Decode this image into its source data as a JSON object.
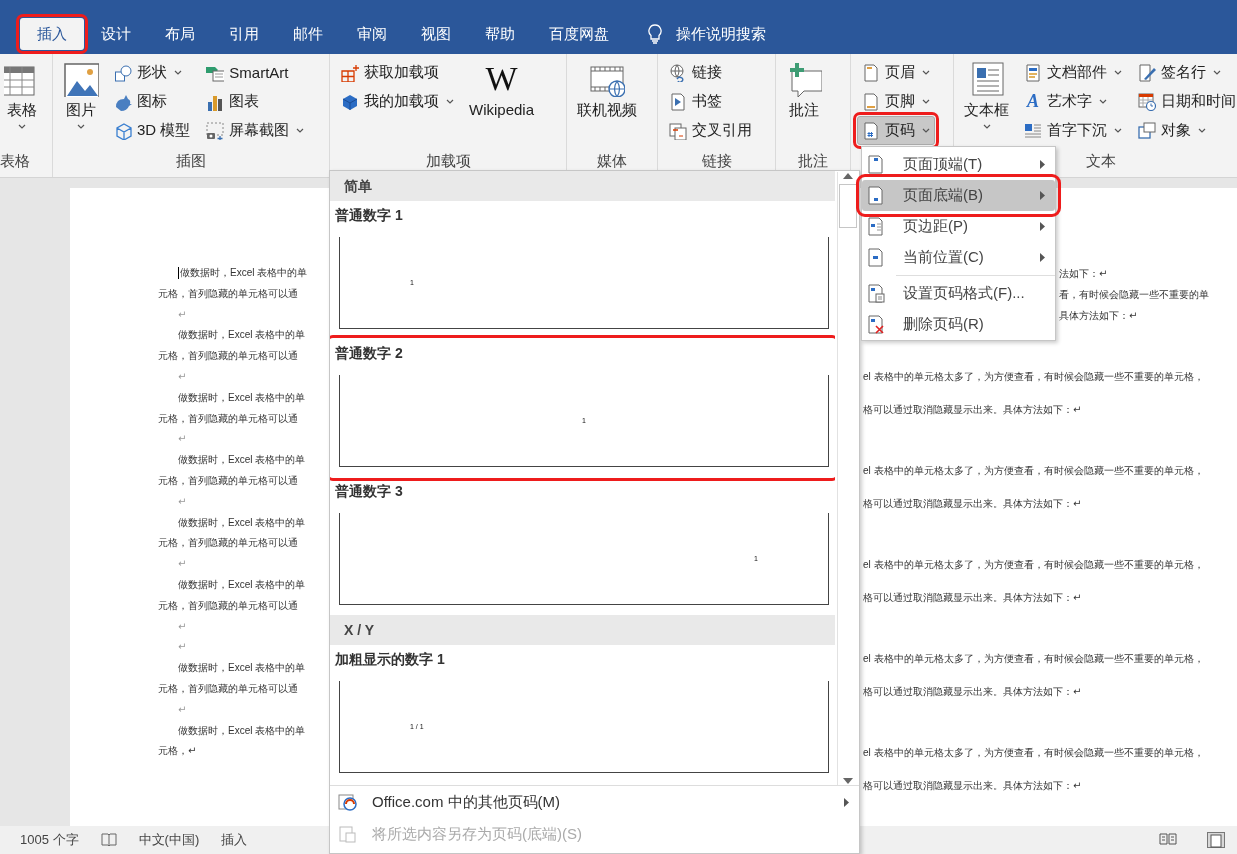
{
  "tabs": [
    {
      "label": "插入",
      "selected": true,
      "highlighted": true
    },
    {
      "label": "设计",
      "selected": false,
      "highlighted": false
    },
    {
      "label": "布局",
      "selected": false,
      "highlighted": false
    },
    {
      "label": "引用",
      "selected": false,
      "highlighted": false
    },
    {
      "label": "邮件",
      "selected": false,
      "highlighted": false
    },
    {
      "label": "审阅",
      "selected": false,
      "highlighted": false
    },
    {
      "label": "视图",
      "selected": false,
      "highlighted": false
    },
    {
      "label": "帮助",
      "selected": false,
      "highlighted": false
    },
    {
      "label": "百度网盘",
      "selected": false,
      "highlighted": false
    }
  ],
  "tell_me": {
    "label": "操作说明搜索"
  },
  "ribbon": {
    "groups": [
      {
        "label": "表格",
        "items": [
          {
            "kind": "large",
            "label": "表格",
            "dropdown": true
          }
        ]
      },
      {
        "label": "插图",
        "items": [
          {
            "kind": "large",
            "label": "图片",
            "dropdown": true
          },
          {
            "kind": "column",
            "buttons": [
              {
                "label": "形状",
                "dropdown": true
              },
              {
                "label": "图标",
                "dropdown": false
              },
              {
                "label": "3D 模型",
                "dropdown": false
              }
            ]
          },
          {
            "kind": "column",
            "buttons": [
              {
                "label": "SmartArt",
                "dropdown": false
              },
              {
                "label": "图表",
                "dropdown": false
              },
              {
                "label": "屏幕截图",
                "dropdown": true
              }
            ]
          }
        ]
      },
      {
        "label": "加载项",
        "items": [
          {
            "kind": "column",
            "buttons": [
              {
                "label": "获取加载项",
                "dropdown": false
              },
              {
                "label": "我的加载项",
                "dropdown": true
              }
            ]
          },
          {
            "kind": "large",
            "label": "Wikipedia",
            "glyph": "W",
            "dropdown": false
          }
        ]
      },
      {
        "label": "媒体",
        "items": [
          {
            "kind": "large",
            "label": "联机视频",
            "dropdown": false
          }
        ]
      },
      {
        "label": "链接",
        "items": [
          {
            "kind": "column",
            "buttons": [
              {
                "label": "链接",
                "dropdown": false
              },
              {
                "label": "书签",
                "dropdown": false
              },
              {
                "label": "交叉引用",
                "dropdown": false
              }
            ]
          }
        ]
      },
      {
        "label": "批注",
        "items": [
          {
            "kind": "large",
            "label": "批注",
            "dropdown": false
          }
        ]
      },
      {
        "items": [
          {
            "kind": "column",
            "buttons": [
              {
                "label": "页眉",
                "dropdown": true,
                "pressed": false,
                "highlighted": false
              },
              {
                "label": "页脚",
                "dropdown": true,
                "pressed": false,
                "highlighted": false
              },
              {
                "label": "页码",
                "dropdown": true,
                "pressed": true,
                "highlighted": true
              }
            ]
          }
        ]
      },
      {
        "label": "文本",
        "items": [
          {
            "kind": "large",
            "label": "文本框",
            "dropdown": true
          },
          {
            "kind": "column",
            "buttons": [
              {
                "label": "文档部件",
                "dropdown": true
              },
              {
                "label": "艺术字",
                "glyph": "A",
                "dropdown": true
              },
              {
                "label": "首字下沉",
                "dropdown": true
              }
            ]
          },
          {
            "kind": "column",
            "buttons": [
              {
                "label": "签名行",
                "dropdown": true
              },
              {
                "label": "日期和时间",
                "dropdown": false
              },
              {
                "label": "对象",
                "dropdown": true
              }
            ]
          }
        ]
      }
    ]
  },
  "document": {
    "left_lines": [
      {
        "kind": "first",
        "text": "做数据时，Excel 表格中的单",
        "cursor": true
      },
      {
        "kind": "cont",
        "text": "元格，首列隐藏的单元格可以通"
      },
      {
        "kind": "mark",
        "text": "↵"
      },
      {
        "kind": "first",
        "text": "做数据时，Excel 表格中的单"
      },
      {
        "kind": "cont",
        "text": "元格，首列隐藏的单元格可以通"
      },
      {
        "kind": "mark",
        "text": "↵"
      },
      {
        "kind": "first",
        "text": "做数据时，Excel 表格中的单"
      },
      {
        "kind": "cont",
        "text": "元格，首列隐藏的单元格可以通"
      },
      {
        "kind": "mark",
        "text": "↵"
      },
      {
        "kind": "first",
        "text": "做数据时，Excel 表格中的单"
      },
      {
        "kind": "cont",
        "text": "元格，首列隐藏的单元格可以通"
      },
      {
        "kind": "mark",
        "text": "↵"
      },
      {
        "kind": "first",
        "text": "做数据时，Excel 表格中的单"
      },
      {
        "kind": "cont",
        "text": "元格，首列隐藏的单元格可以通"
      },
      {
        "kind": "mark",
        "text": "↵"
      },
      {
        "kind": "first",
        "text": "做数据时，Excel 表格中的单"
      },
      {
        "kind": "cont",
        "text": "元格，首列隐藏的单元格可以通"
      },
      {
        "kind": "mark",
        "text": "↵"
      },
      {
        "kind": "mark",
        "text": "↵"
      },
      {
        "kind": "first",
        "text": "做数据时，Excel 表格中的单"
      },
      {
        "kind": "cont",
        "text": "元格，首列隐藏的单元格可以通"
      },
      {
        "kind": "mark",
        "text": "↵"
      },
      {
        "kind": "first",
        "text": "做数据时，Excel 表格中的单"
      },
      {
        "kind": "cont",
        "text": "元格，↵"
      }
    ],
    "right_lines": [
      {
        "kind": "tail",
        "text": "法如下：↵"
      },
      {
        "kind": "tail",
        "text": "看，有时候会隐藏一些不重要的单"
      },
      {
        "kind": "tail",
        "text": "具体方法如下：↵"
      },
      {
        "kind": "first",
        "text": "el 表格中的单元格太多了，为方便查看，有时候会隐藏一些不重要的单元格，"
      },
      {
        "kind": "second",
        "text": "格可以通过取消隐藏显示出来。具体方法如下：↵"
      },
      {
        "kind": "first",
        "text": "el 表格中的单元格太多了，为方便查看，有时候会隐藏一些不重要的单元格，"
      },
      {
        "kind": "second",
        "text": "格可以通过取消隐藏显示出来。具体方法如下：↵"
      },
      {
        "kind": "first",
        "text": "el 表格中的单元格太多了，为方便查看，有时候会隐藏一些不重要的单元格，"
      },
      {
        "kind": "second",
        "text": "格可以通过取消隐藏显示出来。具体方法如下：↵"
      },
      {
        "kind": "first",
        "text": "el 表格中的单元格太多了，为方便查看，有时候会隐藏一些不重要的单元格，"
      },
      {
        "kind": "second",
        "text": "格可以通过取消隐藏显示出来。具体方法如下：↵"
      },
      {
        "kind": "first",
        "text": "el 表格中的单元格太多了，为方便查看，有时候会隐藏一些不重要的单元格，"
      },
      {
        "kind": "second",
        "text": "格可以通过取消隐藏显示出来。具体方法如下：↵"
      }
    ]
  },
  "gallery": {
    "sections": [
      {
        "header": "简单",
        "items": [
          {
            "title": "普通数字 1",
            "preview": "1",
            "kind": "left",
            "highlighted": false
          },
          {
            "title": "普通数字 2",
            "preview": "1",
            "kind": "center",
            "highlighted": true
          },
          {
            "title": "普通数字 3",
            "preview": "1",
            "kind": "right",
            "highlighted": false
          }
        ]
      },
      {
        "header": "X / Y",
        "items": [
          {
            "title": "加粗显示的数字 1",
            "preview": "1 / 1",
            "kind": "left",
            "highlighted": false
          }
        ]
      }
    ],
    "footer_items": [
      {
        "label": "Office.com 中的其他页码(M)",
        "submenu": true,
        "disabled": false
      },
      {
        "label": "将所选内容另存为页码(底端)(S)",
        "submenu": false,
        "disabled": true
      }
    ]
  },
  "submenu": {
    "items": [
      {
        "label": "页面顶端(T)",
        "submenu": true,
        "selected": false,
        "highlighted": false,
        "separator_before": false
      },
      {
        "label": "页面底端(B)",
        "submenu": true,
        "selected": true,
        "highlighted": true,
        "separator_before": false
      },
      {
        "label": "页边距(P)",
        "submenu": true,
        "selected": false,
        "highlighted": false,
        "separator_before": false
      },
      {
        "label": "当前位置(C)",
        "submenu": true,
        "selected": false,
        "highlighted": false,
        "separator_before": false
      },
      {
        "label": "设置页码格式(F)...",
        "submenu": false,
        "selected": false,
        "highlighted": false,
        "separator_before": true
      },
      {
        "label": "删除页码(R)",
        "submenu": false,
        "selected": false,
        "highlighted": false,
        "separator_before": false
      }
    ]
  },
  "status_bar": {
    "word_count": "1005 个字",
    "language": "中文(中国)",
    "mode": "插入"
  }
}
